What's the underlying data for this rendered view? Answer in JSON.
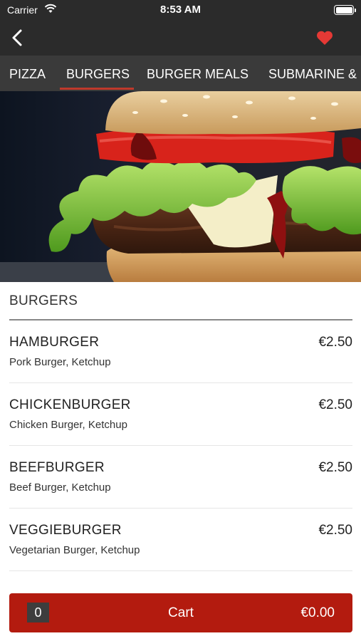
{
  "status_bar": {
    "carrier": "Carrier",
    "time": "8:53 AM"
  },
  "nav": {
    "back_icon": "chevron-left-icon",
    "favorite_icon": "heart-icon",
    "accent_color": "#e53935"
  },
  "tabs": [
    {
      "label": "PIZZA"
    },
    {
      "label": "BURGERS",
      "active": true
    },
    {
      "label": "BURGER MEALS"
    },
    {
      "label": "SUBMARINE &"
    }
  ],
  "section": {
    "title": "BURGERS"
  },
  "items": [
    {
      "name": "HAMBURGER",
      "description": "Pork Burger, Ketchup",
      "price": "€2.50"
    },
    {
      "name": "CHICKENBURGER",
      "description": "Chicken Burger, Ketchup",
      "price": "€2.50"
    },
    {
      "name": "BEEFBURGER",
      "description": "Beef Burger, Ketchup",
      "price": "€2.50"
    },
    {
      "name": "VEGGIEBURGER",
      "description": "Vegetarian Burger, Ketchup",
      "price": "€2.50"
    }
  ],
  "cart": {
    "count": "0",
    "label": "Cart",
    "total": "€0.00",
    "color": "#b31b0f"
  }
}
